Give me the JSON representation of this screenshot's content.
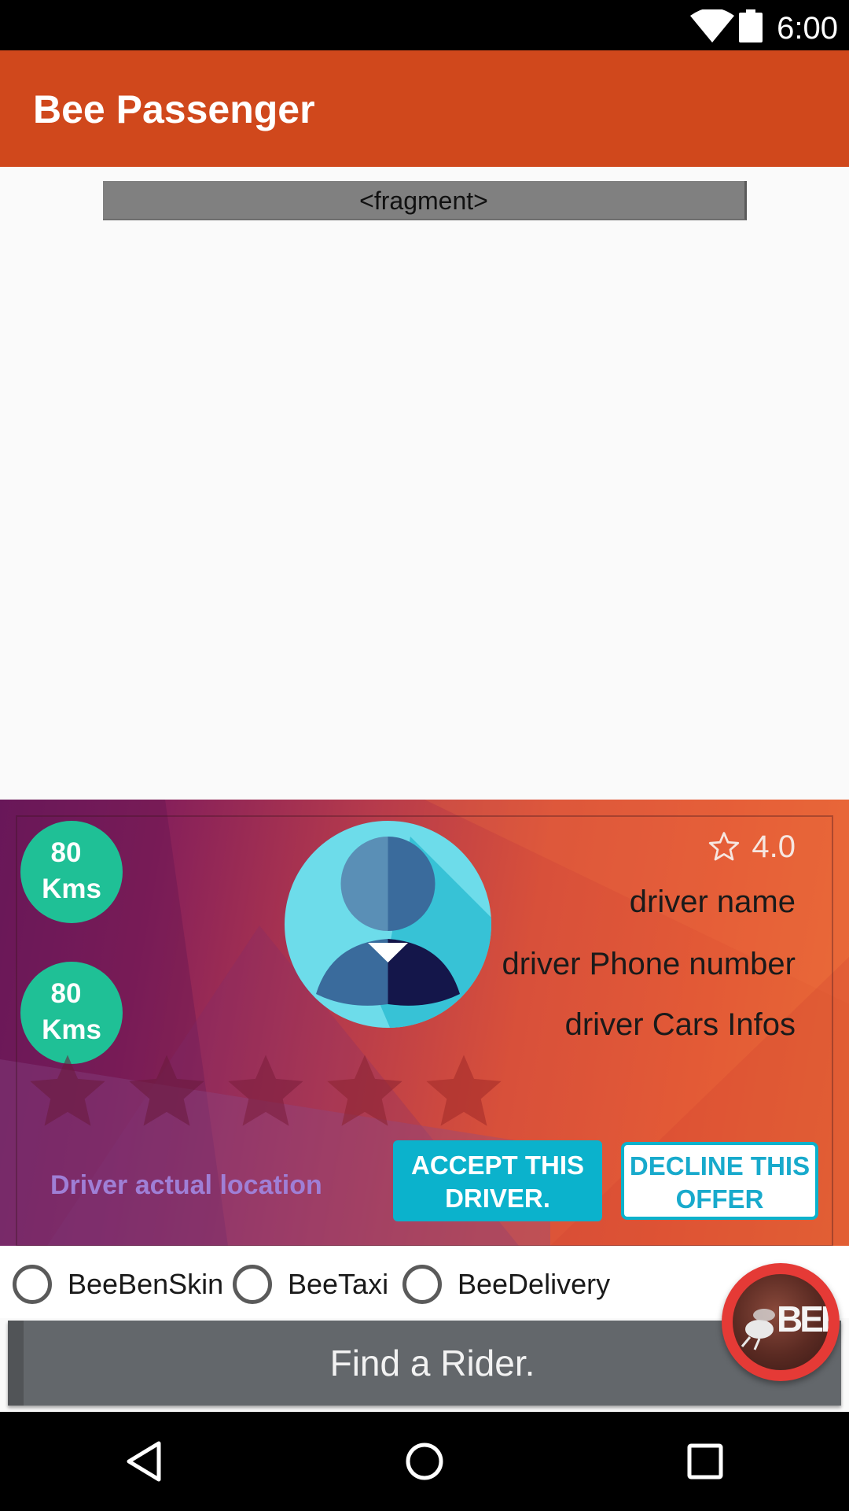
{
  "status_bar": {
    "time": "6:00"
  },
  "app_bar": {
    "title": "Bee Passenger",
    "color": "#d0481c"
  },
  "fragment": {
    "label": "<fragment>"
  },
  "driver_card": {
    "distance_badges": [
      {
        "value": "80",
        "unit": "Kms"
      },
      {
        "value": "80",
        "unit": "Kms"
      }
    ],
    "avatar_icon": "driver-avatar-icon",
    "rating": {
      "icon": "star-outline-icon",
      "value": "4.0"
    },
    "driver_name": "driver name",
    "driver_phone": "driver Phone number",
    "driver_cars": "driver Cars Infos",
    "rating_stars": {
      "count": 5,
      "filled": 0
    },
    "location_label": "Driver actual location",
    "accept_button": "ACCEPT THIS DRIVER.",
    "decline_button": "DECLINE THIS OFFER",
    "accent_color": "#0bb2cc"
  },
  "service_options": [
    {
      "label": "BeeBenSkin",
      "selected": false
    },
    {
      "label": "BeeTaxi",
      "selected": false
    },
    {
      "label": "BeeDelivery",
      "selected": false
    }
  ],
  "find_button": {
    "label": "Find a Rider."
  },
  "logo_fab": {
    "text": "BEE",
    "icon": "bee-logo-icon"
  },
  "nav_bar": {
    "icons": [
      "back-icon",
      "home-icon",
      "recents-icon"
    ]
  }
}
